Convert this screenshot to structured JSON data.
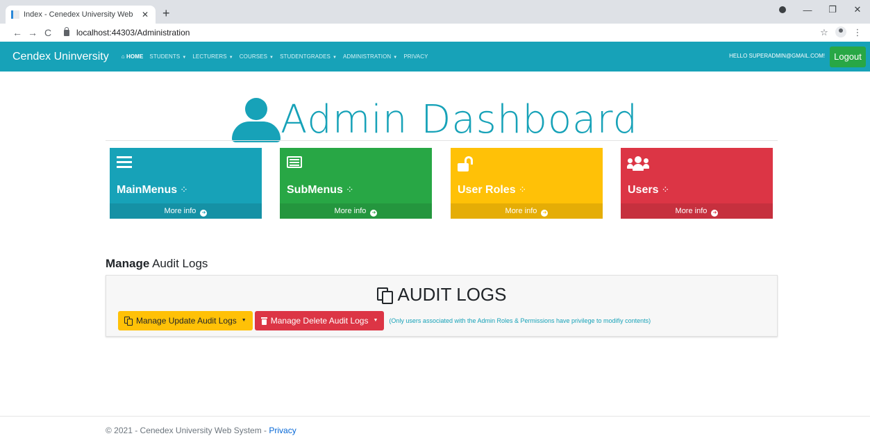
{
  "browser": {
    "tab_title": "Index - Cenedex University Web",
    "tab_close": "✕",
    "new_tab": "+",
    "url": "localhost:44303/Administration",
    "back": "←",
    "forward": "→",
    "reload": "C",
    "star": "☆",
    "menu": "⋮",
    "minimize": "—",
    "restore": "❐",
    "close": "✕"
  },
  "navbar": {
    "brand": "Cendex Uninversity",
    "items": [
      {
        "label": "HOME",
        "active": true
      },
      {
        "label": "STUDENTS"
      },
      {
        "label": "LECTURERS"
      },
      {
        "label": "COURSES"
      },
      {
        "label": "STUDENTGRADES"
      },
      {
        "label": "ADMINISTRATION"
      },
      {
        "label": "PRIVACY"
      }
    ],
    "home_icon": "home-icon",
    "greeting": "HELLO SUPERADMIN@GMAIL.COM!",
    "logout": "Logout"
  },
  "dashboard": {
    "title": "Admin Dashboard",
    "icon": "user-icon",
    "cards": [
      {
        "title": "MainMenus",
        "footer": "More info",
        "icon": "bars-icon",
        "color": "#17a2b8"
      },
      {
        "title": "SubMenus",
        "footer": "More info",
        "icon": "list-alt-icon",
        "color": "#28a745"
      },
      {
        "title": "User Roles",
        "footer": "More info",
        "icon": "unlock-icon",
        "color": "#ffc107"
      },
      {
        "title": "Users",
        "footer": "More info",
        "icon": "users-icon",
        "color": "#dc3545"
      }
    ]
  },
  "audit": {
    "heading_bold": "Manage",
    "heading_rest": " Audit Logs",
    "box_title": "AUDIT LOGS",
    "update_button": "Manage Update Audit Logs",
    "delete_button": "Manage Delete Audit Logs",
    "note": "(Only users associated with the Admin Roles & Permissions have privilege to modifiy contents)"
  },
  "footer": {
    "text": "© 2021 - Cenedex University Web System - ",
    "privacy_link": "Privacy"
  },
  "colors": {
    "primary": "#17a2b8",
    "success": "#28a745",
    "warning": "#ffc107",
    "danger": "#dc3545"
  }
}
